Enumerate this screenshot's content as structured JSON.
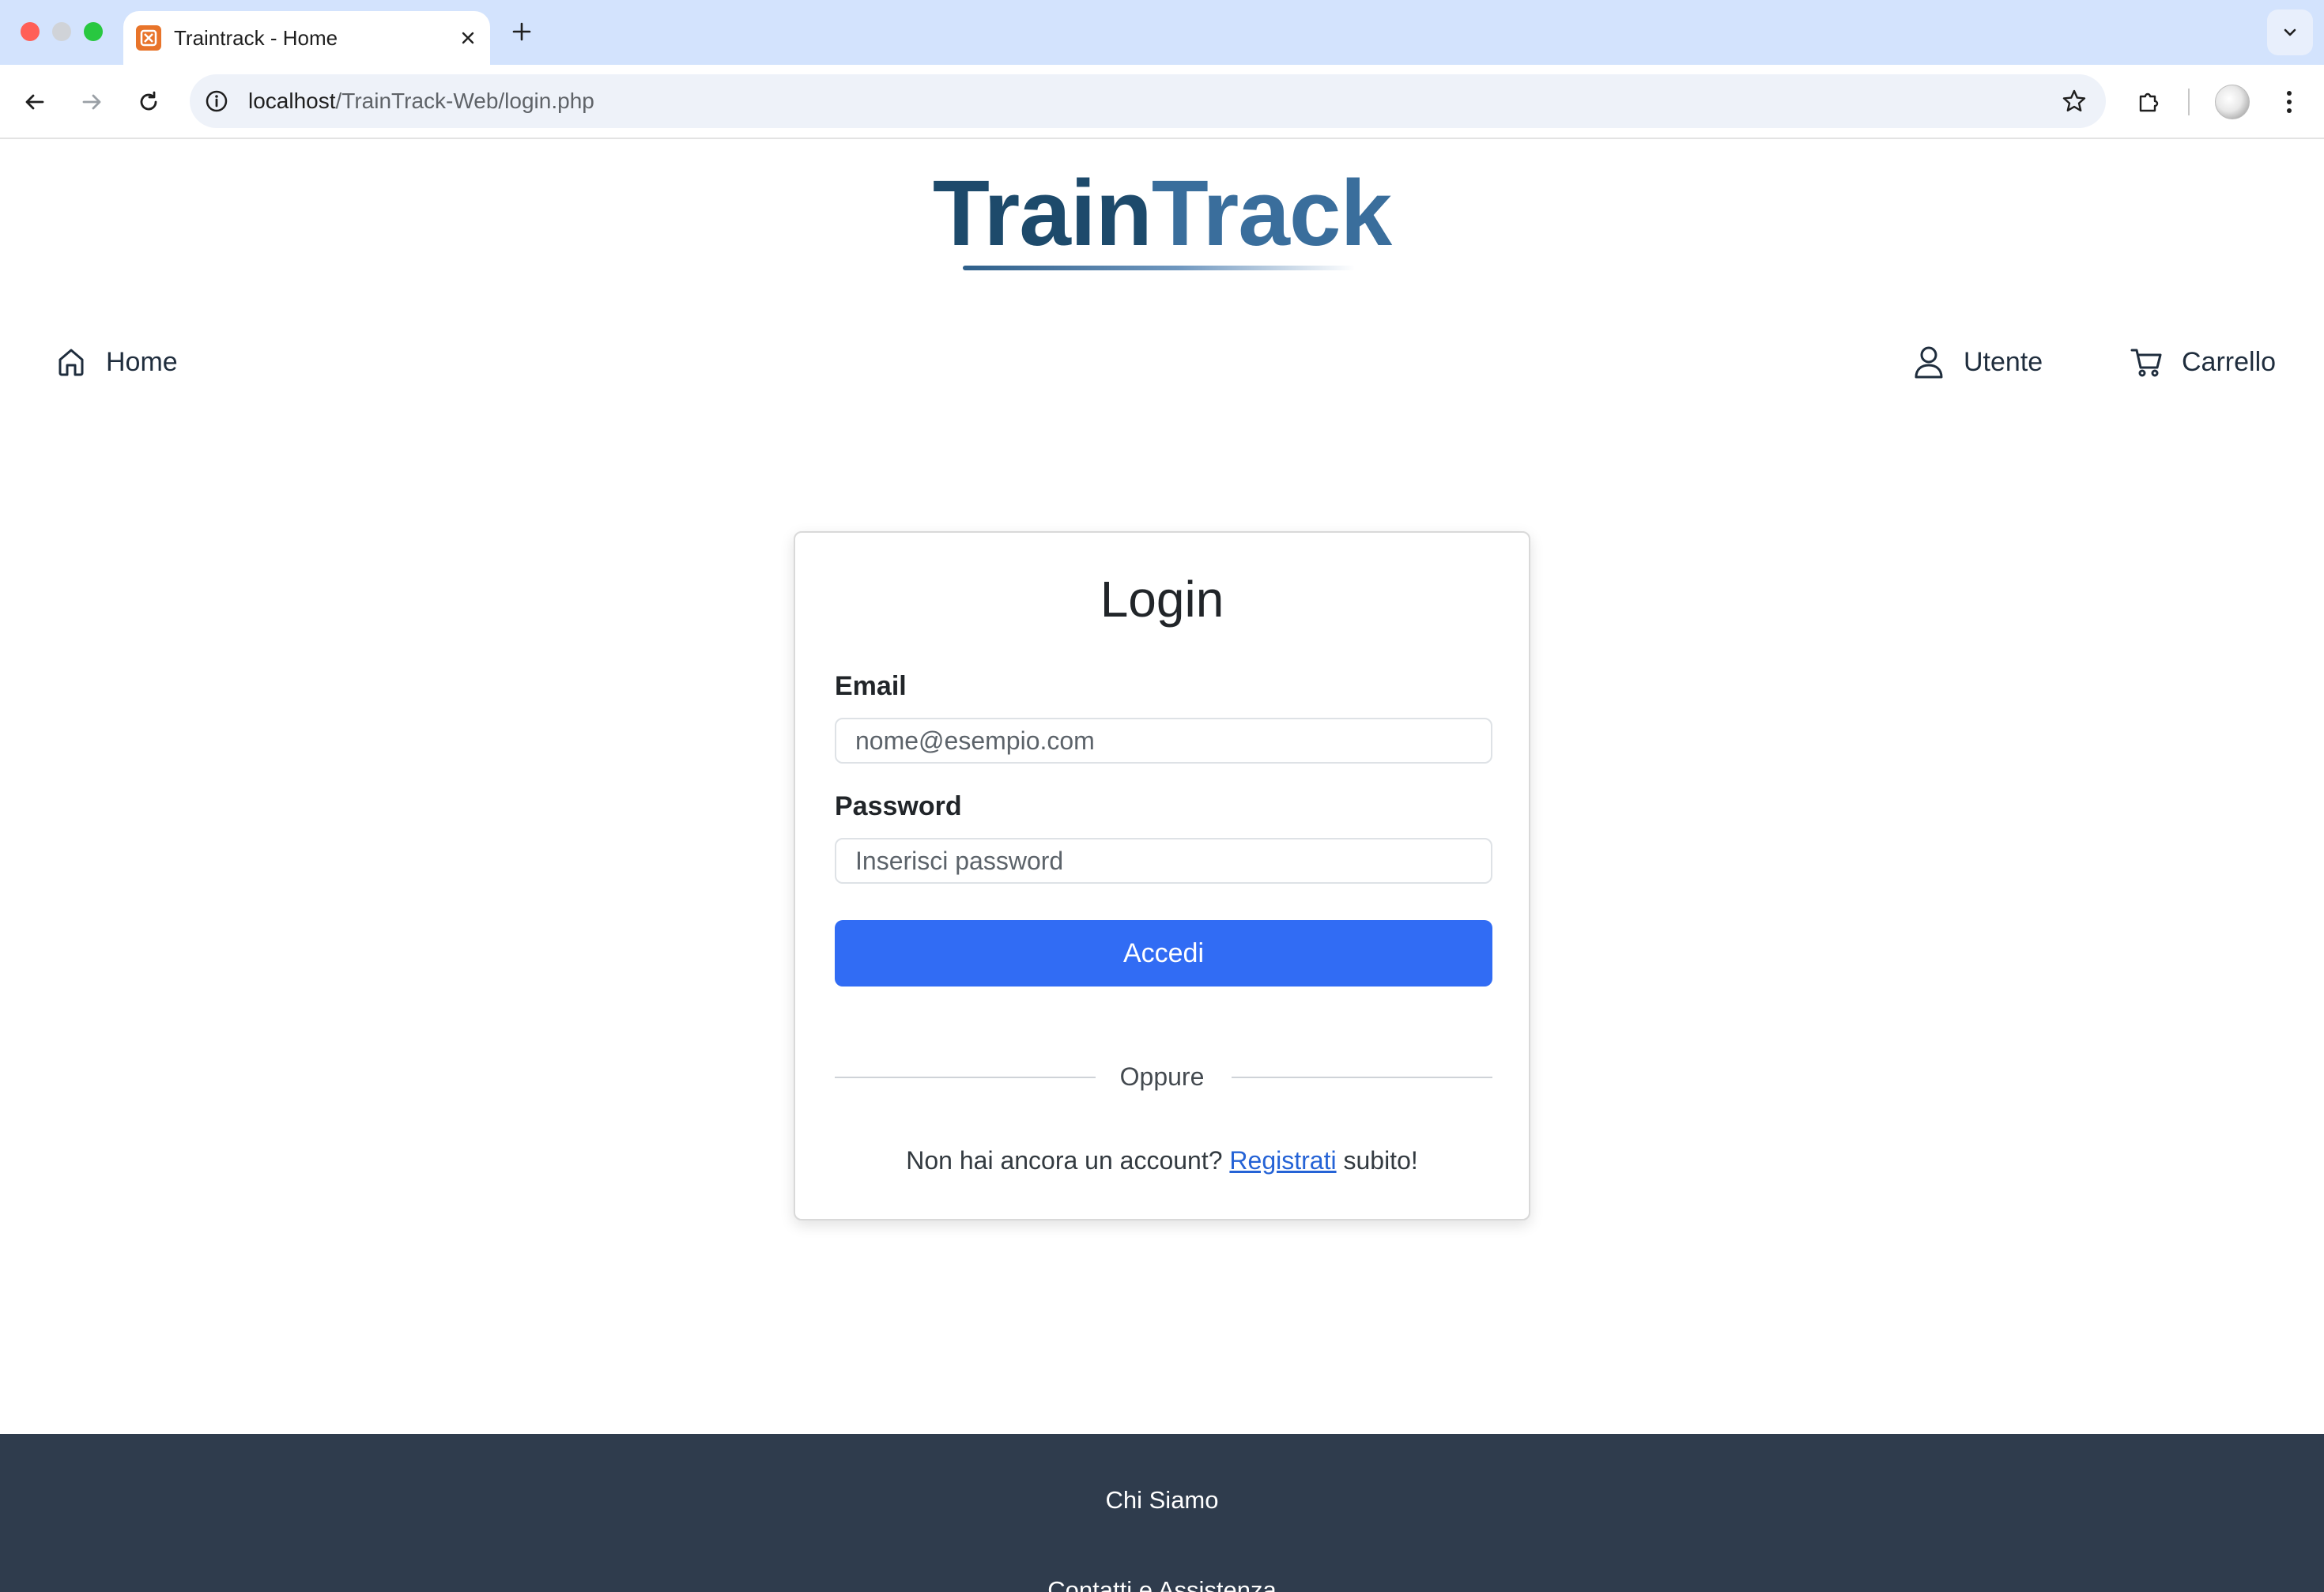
{
  "browser": {
    "tab_title": "Traintrack - Home",
    "url_host": "localhost",
    "url_path": "/TrainTrack-Web/login.php"
  },
  "logo": {
    "part1": "Train",
    "part2": "Track"
  },
  "nav": {
    "home": "Home",
    "user": "Utente",
    "cart": "Carrello"
  },
  "login": {
    "title": "Login",
    "email_label": "Email",
    "email_placeholder": "nome@esempio.com",
    "password_label": "Password",
    "password_placeholder": "Inserisci password",
    "submit_label": "Accedi",
    "divider": "Oppure",
    "signup_prefix": "Non hai ancora un account?",
    "signup_link": "Registrati",
    "signup_suffix": "subito!"
  },
  "footer": {
    "links": [
      "Chi Siamo",
      "Contatti e Assistenza"
    ]
  },
  "colors": {
    "primary": "#316cf4",
    "logo_dark": "#1d4a6b",
    "logo_light": "#3a6e9c",
    "footer_bg": "#2f3c4d",
    "tabstrip_bg": "#d3e3fd"
  }
}
